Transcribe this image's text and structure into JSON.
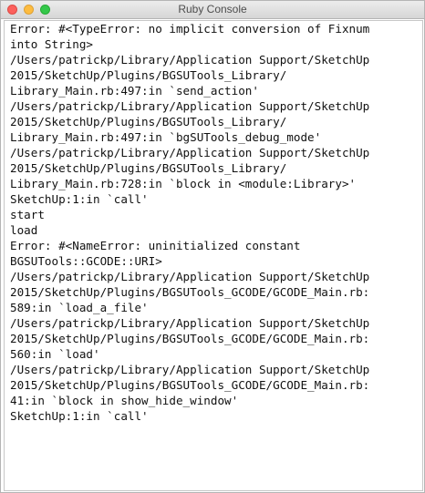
{
  "window": {
    "title": "Ruby Console"
  },
  "console": {
    "lines": [
      "Error: #<TypeError: no implicit conversion of Fixnum",
      "into String>",
      "/Users/patrickp/Library/Application Support/SketchUp",
      "2015/SketchUp/Plugins/BGSUTools_Library/",
      "Library_Main.rb:497:in `send_action'",
      "/Users/patrickp/Library/Application Support/SketchUp",
      "2015/SketchUp/Plugins/BGSUTools_Library/",
      "Library_Main.rb:497:in `bgSUTools_debug_mode'",
      "/Users/patrickp/Library/Application Support/SketchUp",
      "2015/SketchUp/Plugins/BGSUTools_Library/",
      "Library_Main.rb:728:in `block in <module:Library>'",
      "SketchUp:1:in `call'",
      "start",
      "load",
      "Error: #<NameError: uninitialized constant",
      "BGSUTools::GCODE::URI>",
      "/Users/patrickp/Library/Application Support/SketchUp",
      "2015/SketchUp/Plugins/BGSUTools_GCODE/GCODE_Main.rb:",
      "589:in `load_a_file'",
      "/Users/patrickp/Library/Application Support/SketchUp",
      "2015/SketchUp/Plugins/BGSUTools_GCODE/GCODE_Main.rb:",
      "560:in `load'",
      "/Users/patrickp/Library/Application Support/SketchUp",
      "2015/SketchUp/Plugins/BGSUTools_GCODE/GCODE_Main.rb:",
      "41:in `block in show_hide_window'",
      "SketchUp:1:in `call'"
    ]
  }
}
